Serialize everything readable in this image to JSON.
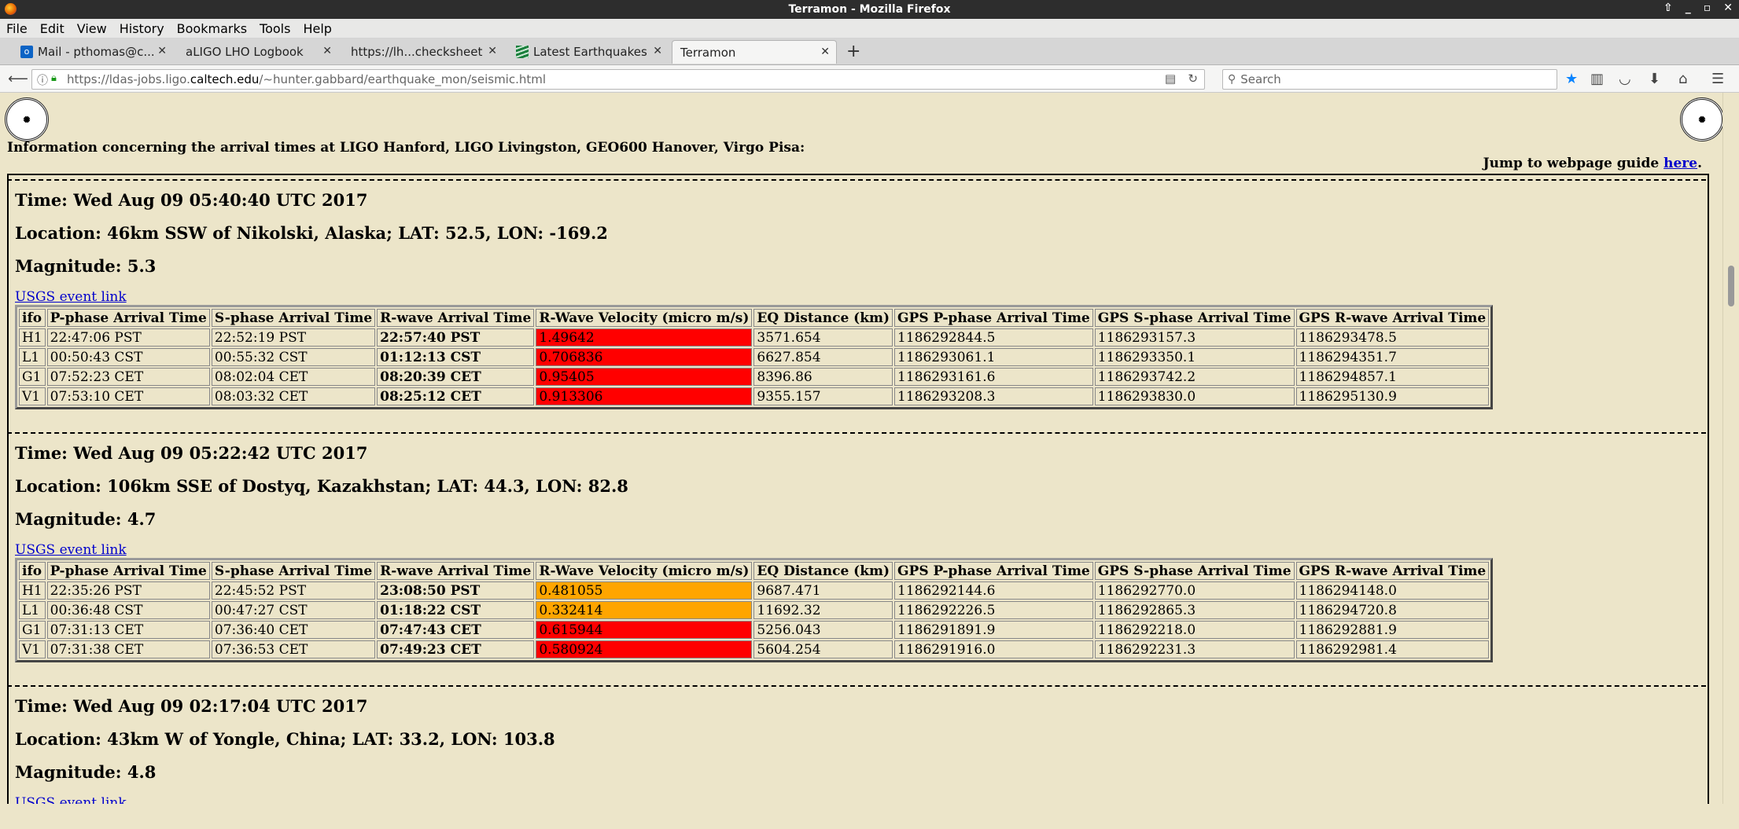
{
  "window": {
    "title": "Terramon - Mozilla Firefox"
  },
  "menu": [
    "File",
    "Edit",
    "View",
    "History",
    "Bookmarks",
    "Tools",
    "Help"
  ],
  "tabs": [
    {
      "label": "Mail - pthomas@c...",
      "icon": "outlook-icon",
      "active": false
    },
    {
      "label": "aLIGO LHO Logbook",
      "icon": "",
      "active": false
    },
    {
      "label": "https://lh...checksheet",
      "icon": "",
      "active": false
    },
    {
      "label": "Latest Earthquakes",
      "icon": "usgs-icon",
      "active": false
    },
    {
      "label": "Terramon",
      "icon": "",
      "active": true
    }
  ],
  "nav": {
    "url_prefix": "https://ldas-jobs.ligo.",
    "url_domain": "caltech.edu",
    "url_path": "/~hunter.gabbard/earthquake_mon/seismic.html",
    "search_placeholder": "Search"
  },
  "page": {
    "intro": "Information concerning the arrival times at LIGO Hanford, LIGO Livingston, GEO600 Hanover, Virgo Pisa:",
    "guide_prefix": "Jump to webpage guide ",
    "guide_link": "here",
    "guide_suffix": ".",
    "usgs_link": "USGS event link",
    "columns": [
      "ifo",
      "P-phase Arrival Time",
      "S-phase Arrival Time",
      "R-wave Arrival Time",
      "R-Wave Velocity (micro m/s)",
      "EQ Distance (km)",
      "GPS P-phase Arrival Time",
      "GPS S-phase Arrival Time",
      "GPS R-wave Arrival Time"
    ],
    "colors": {
      "red": "#ff0000",
      "orange": "#ffa500"
    }
  },
  "events": [
    {
      "time": "Time: Wed Aug 09 05:40:40 UTC 2017",
      "location": "Location: 46km SSW of Nikolski, Alaska; LAT: 52.5, LON: -169.2",
      "magnitude": "Magnitude: 5.3",
      "rows": [
        {
          "ifo": "H1",
          "p": "22:47:06 PST",
          "s": "22:52:19 PST",
          "r": "22:57:40 PST",
          "vel": "1.49642",
          "vel_color": "red",
          "dist": "3571.654",
          "gp": "1186292844.5",
          "gs": "1186293157.3",
          "gr": "1186293478.5"
        },
        {
          "ifo": "L1",
          "p": "00:50:43 CST",
          "s": "00:55:32 CST",
          "r": "01:12:13 CST",
          "vel": "0.706836",
          "vel_color": "red",
          "dist": "6627.854",
          "gp": "1186293061.1",
          "gs": "1186293350.1",
          "gr": "1186294351.7"
        },
        {
          "ifo": "G1",
          "p": "07:52:23 CET",
          "s": "08:02:04 CET",
          "r": "08:20:39 CET",
          "vel": "0.95405",
          "vel_color": "red",
          "dist": "8396.86",
          "gp": "1186293161.6",
          "gs": "1186293742.2",
          "gr": "1186294857.1"
        },
        {
          "ifo": "V1",
          "p": "07:53:10 CET",
          "s": "08:03:32 CET",
          "r": "08:25:12 CET",
          "vel": "0.913306",
          "vel_color": "red",
          "dist": "9355.157",
          "gp": "1186293208.3",
          "gs": "1186293830.0",
          "gr": "1186295130.9"
        }
      ]
    },
    {
      "time": "Time: Wed Aug 09 05:22:42 UTC 2017",
      "location": "Location: 106km SSE of Dostyq, Kazakhstan; LAT: 44.3, LON: 82.8",
      "magnitude": "Magnitude: 4.7",
      "rows": [
        {
          "ifo": "H1",
          "p": "22:35:26 PST",
          "s": "22:45:52 PST",
          "r": "23:08:50 PST",
          "vel": "0.481055",
          "vel_color": "orange",
          "dist": "9687.471",
          "gp": "1186292144.6",
          "gs": "1186292770.0",
          "gr": "1186294148.0"
        },
        {
          "ifo": "L1",
          "p": "00:36:48 CST",
          "s": "00:47:27 CST",
          "r": "01:18:22 CST",
          "vel": "0.332414",
          "vel_color": "orange",
          "dist": "11692.32",
          "gp": "1186292226.5",
          "gs": "1186292865.3",
          "gr": "1186294720.8"
        },
        {
          "ifo": "G1",
          "p": "07:31:13 CET",
          "s": "07:36:40 CET",
          "r": "07:47:43 CET",
          "vel": "0.615944",
          "vel_color": "red",
          "dist": "5256.043",
          "gp": "1186291891.9",
          "gs": "1186292218.0",
          "gr": "1186292881.9"
        },
        {
          "ifo": "V1",
          "p": "07:31:38 CET",
          "s": "07:36:53 CET",
          "r": "07:49:23 CET",
          "vel": "0.580924",
          "vel_color": "red",
          "dist": "5604.254",
          "gp": "1186291916.0",
          "gs": "1186292231.3",
          "gr": "1186292981.4"
        }
      ]
    },
    {
      "time": "Time: Wed Aug 09 02:17:04 UTC 2017",
      "location": "Location: 43km W of Yongle, China; LAT: 33.2, LON: 103.8",
      "magnitude": "Magnitude: 4.8",
      "rows": []
    }
  ]
}
